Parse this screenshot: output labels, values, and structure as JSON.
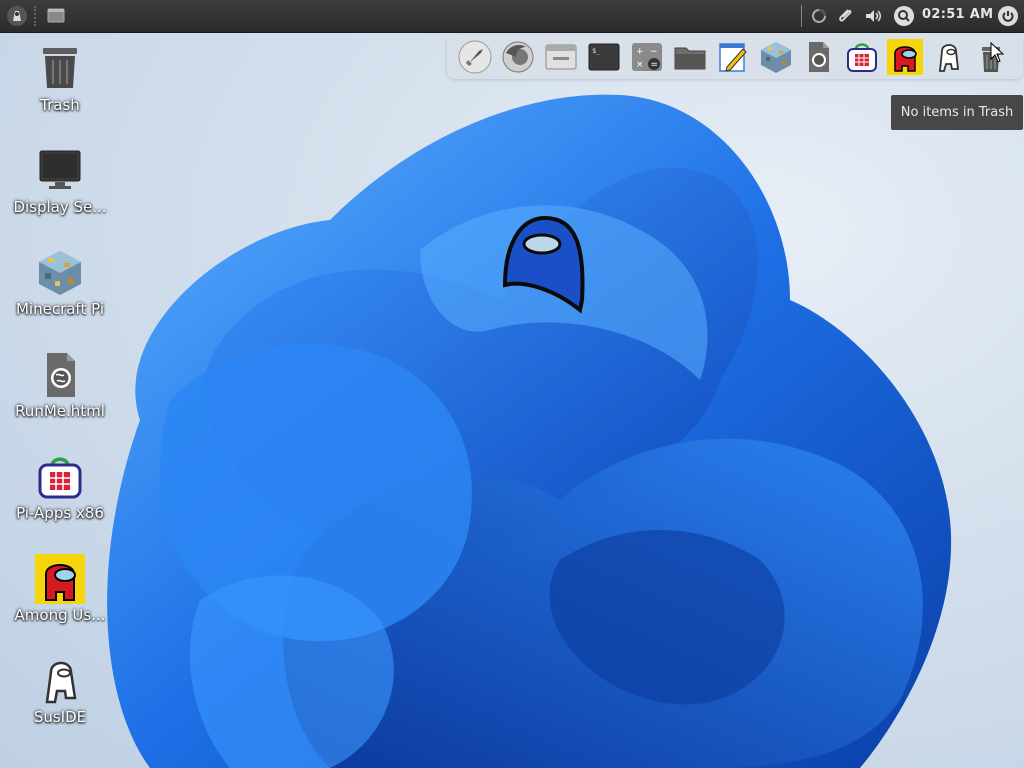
{
  "taskbar": {
    "menu_icon": "app-menu-icon",
    "window_icon": "window-icon",
    "clock": "02:51 AM",
    "tray": [
      "update-spinner-icon",
      "clipboard-icon",
      "volume-icon",
      "search-icon",
      "power-icon"
    ]
  },
  "dock": {
    "items": [
      {
        "name": "launcher",
        "icon": "rocket-icon"
      },
      {
        "name": "firefox",
        "icon": "firefox-icon"
      },
      {
        "name": "app-window",
        "icon": "window-app-icon"
      },
      {
        "name": "terminal",
        "icon": "terminal-icon"
      },
      {
        "name": "calculator",
        "icon": "calculator-icon"
      },
      {
        "name": "file-manager",
        "icon": "folder-icon"
      },
      {
        "name": "text-editor",
        "icon": "text-editor-icon"
      },
      {
        "name": "minecraft-pi",
        "icon": "minecraft-icon"
      },
      {
        "name": "runme-html",
        "icon": "html-file-icon"
      },
      {
        "name": "pi-apps",
        "icon": "pi-apps-icon"
      },
      {
        "name": "among-us",
        "icon": "among-us-icon"
      },
      {
        "name": "susIDE",
        "icon": "susIDE-icon"
      },
      {
        "name": "trash",
        "icon": "trash-icon"
      }
    ]
  },
  "tooltip": {
    "text": "No items in Trash"
  },
  "desktop": {
    "icons": [
      {
        "label": "Trash",
        "icon": "trash-icon"
      },
      {
        "label": "Display Se...",
        "icon": "display-icon"
      },
      {
        "label": "Minecraft Pi",
        "icon": "minecraft-icon"
      },
      {
        "label": "RunMe.html",
        "icon": "html-file-icon"
      },
      {
        "label": "Pi-Apps x86",
        "icon": "pi-apps-icon"
      },
      {
        "label": "Among Us...",
        "icon": "among-us-icon"
      },
      {
        "label": "SusIDE",
        "icon": "susIDE-icon"
      }
    ]
  },
  "colors": {
    "panel": "#2f2f2f",
    "bloom_blue": "#1e6fe6",
    "tooltip_bg": "#474747"
  }
}
